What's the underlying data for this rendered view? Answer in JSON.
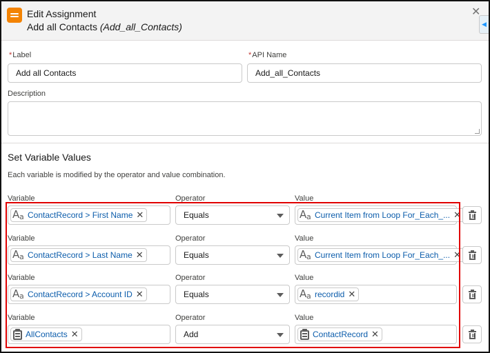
{
  "header": {
    "type_label": "Edit Assignment",
    "element_label": "Add all Contacts",
    "element_api_name": "(Add_all_Contacts)"
  },
  "fields": {
    "label": {
      "label": "Label",
      "value": "Add all Contacts"
    },
    "api_name": {
      "label": "API Name",
      "value": "Add_all_Contacts"
    },
    "description": {
      "label": "Description",
      "value": ""
    }
  },
  "section": {
    "title": "Set Variable Values",
    "description": "Each variable is modified by the operator and value combination."
  },
  "rows": [
    {
      "variable_label": "Variable",
      "operator_label": "Operator",
      "value_label": "Value",
      "variable": "ContactRecord > First Name",
      "variable_icon": "text-icon",
      "operator": "Equals",
      "value": "Current Item from Loop For_Each_...",
      "value_icon": "text-icon"
    },
    {
      "variable_label": "Variable",
      "operator_label": "Operator",
      "value_label": "Value",
      "variable": "ContactRecord > Last Name",
      "variable_icon": "text-icon",
      "operator": "Equals",
      "value": "Current Item from Loop For_Each_...",
      "value_icon": "text-icon"
    },
    {
      "variable_label": "Variable",
      "operator_label": "Operator",
      "value_label": "Value",
      "variable": "ContactRecord > Account ID",
      "variable_icon": "text-icon",
      "operator": "Equals",
      "value": "recordid",
      "value_icon": "text-icon"
    },
    {
      "variable_label": "Variable",
      "operator_label": "Operator",
      "value_label": "Value",
      "variable": "AllContacts",
      "variable_icon": "collection-icon",
      "operator": "Add",
      "value": "ContactRecord",
      "value_icon": "record-icon"
    }
  ],
  "colors": {
    "header_icon": "#f38303",
    "pill_text": "#0b5cab",
    "highlight": "#e00000",
    "required": "#c23934"
  }
}
